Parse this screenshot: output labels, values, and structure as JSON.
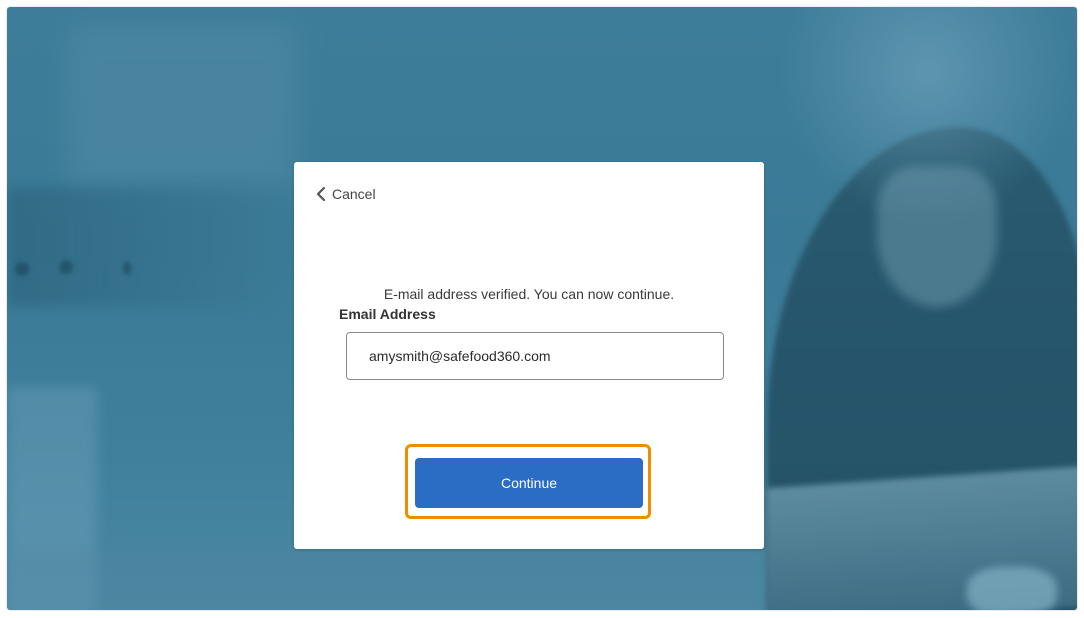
{
  "dialog": {
    "cancel_label": "Cancel",
    "message": "E-mail address verified. You can now continue.",
    "email_label": "Email Address",
    "email_value": "amysmith@safefood360.com",
    "continue_label": "Continue"
  },
  "icons": {
    "cancel": "chevron-left-icon"
  },
  "colors": {
    "background_overlay": "#3e7d99",
    "button": "#2b6cc4",
    "highlight": "#f08c00",
    "card": "#ffffff"
  }
}
